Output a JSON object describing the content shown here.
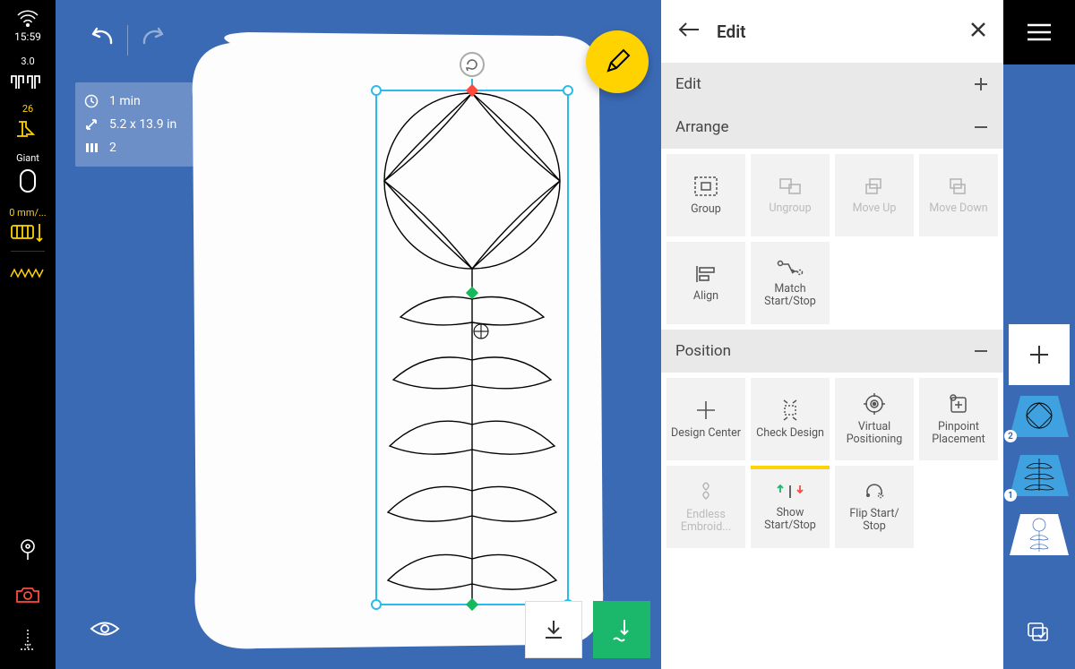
{
  "leftbar": {
    "time": "15:59",
    "speed": "3.0",
    "foot_number": "26",
    "hoop_label": "Giant",
    "offset": "0 mm/..."
  },
  "info": {
    "time": "1 min",
    "dimensions": "5.2 x 13.9 in",
    "layers": "2"
  },
  "panel": {
    "title": "Edit",
    "sections": {
      "edit": "Edit",
      "arrange": "Arrange",
      "position": "Position"
    },
    "arrange": {
      "group": "Group",
      "ungroup": "Ungroup",
      "move_up": "Move Up",
      "move_down": "Move Down",
      "align": "Align",
      "match": "Match Start/Stop"
    },
    "position": {
      "design_center": "Design Center",
      "check_design": "Check Design",
      "virtual_pos": "Virtual Positioning",
      "pinpoint": "Pinpoint Placement",
      "endless": "Endless Embroid...",
      "show_start_stop": "Show Start/Stop",
      "flip": "Flip Start/ Stop"
    }
  },
  "thumbs": {
    "n1": "2",
    "n2": "1"
  }
}
